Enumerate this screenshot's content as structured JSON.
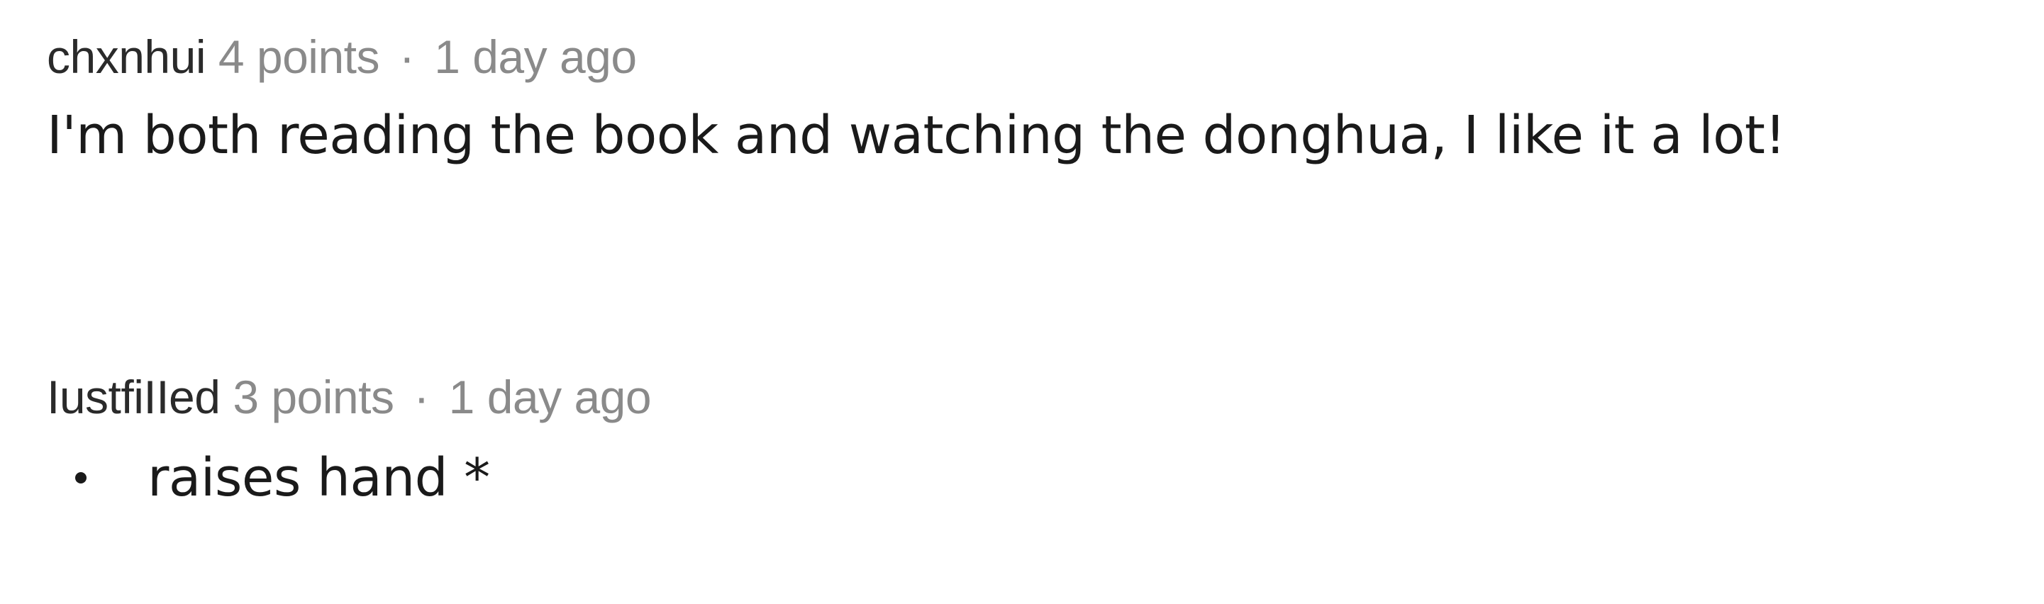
{
  "comments": [
    {
      "author": "chxnhui",
      "score": "4 points",
      "separator": "·",
      "time": "1 day ago",
      "body": "I'm both reading the book and watching the donghua, I like it a lot!"
    },
    {
      "author": "IustfiIIed",
      "score": "3 points",
      "separator": "·",
      "time": "1 day ago",
      "body_list": [
        "raises hand *"
      ]
    }
  ],
  "colors": {
    "author": "#2a2a2a",
    "meta": "#8a8a8a",
    "body": "#1a1a1a",
    "background": "#ffffff"
  }
}
